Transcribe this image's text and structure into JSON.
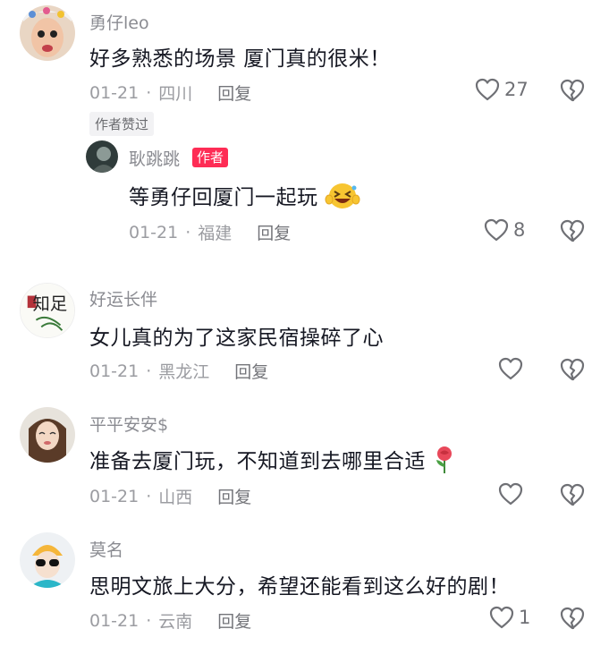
{
  "comments": [
    {
      "username": "勇仔leo",
      "text": "好多熟悉的场景 厦门真的很米！",
      "date": "01-21",
      "location": "四川",
      "reply_label": "回复",
      "likes": "27",
      "liked_by_author_label": "作者赞过"
    },
    {
      "username": "耿跳跳",
      "author_tag": "作者",
      "text": "等勇仔回厦门一起玩",
      "emoji": "laughing-wink-emoji",
      "date": "01-21",
      "location": "福建",
      "reply_label": "回复",
      "likes": "8"
    },
    {
      "username": "好运长伴",
      "text": "女儿真的为了这家民宿操碎了心",
      "date": "01-21",
      "location": "黑龙江",
      "reply_label": "回复",
      "likes": ""
    },
    {
      "username": "平平安安$",
      "text": "准备去厦门玩，不知道到去哪里合适",
      "emoji": "rose-emoji",
      "date": "01-21",
      "location": "山西",
      "reply_label": "回复",
      "likes": ""
    },
    {
      "username": "莫名",
      "text": "思明文旅上大分，希望还能看到这么好的剧！",
      "date": "01-21",
      "location": "云南",
      "reply_label": "回复",
      "likes": "1"
    }
  ],
  "avatar_logo_text": "知足",
  "colors": {
    "author_tag_bg": "#fe2c55",
    "username": "#8a8b91",
    "meta": "#9b9ca1"
  }
}
